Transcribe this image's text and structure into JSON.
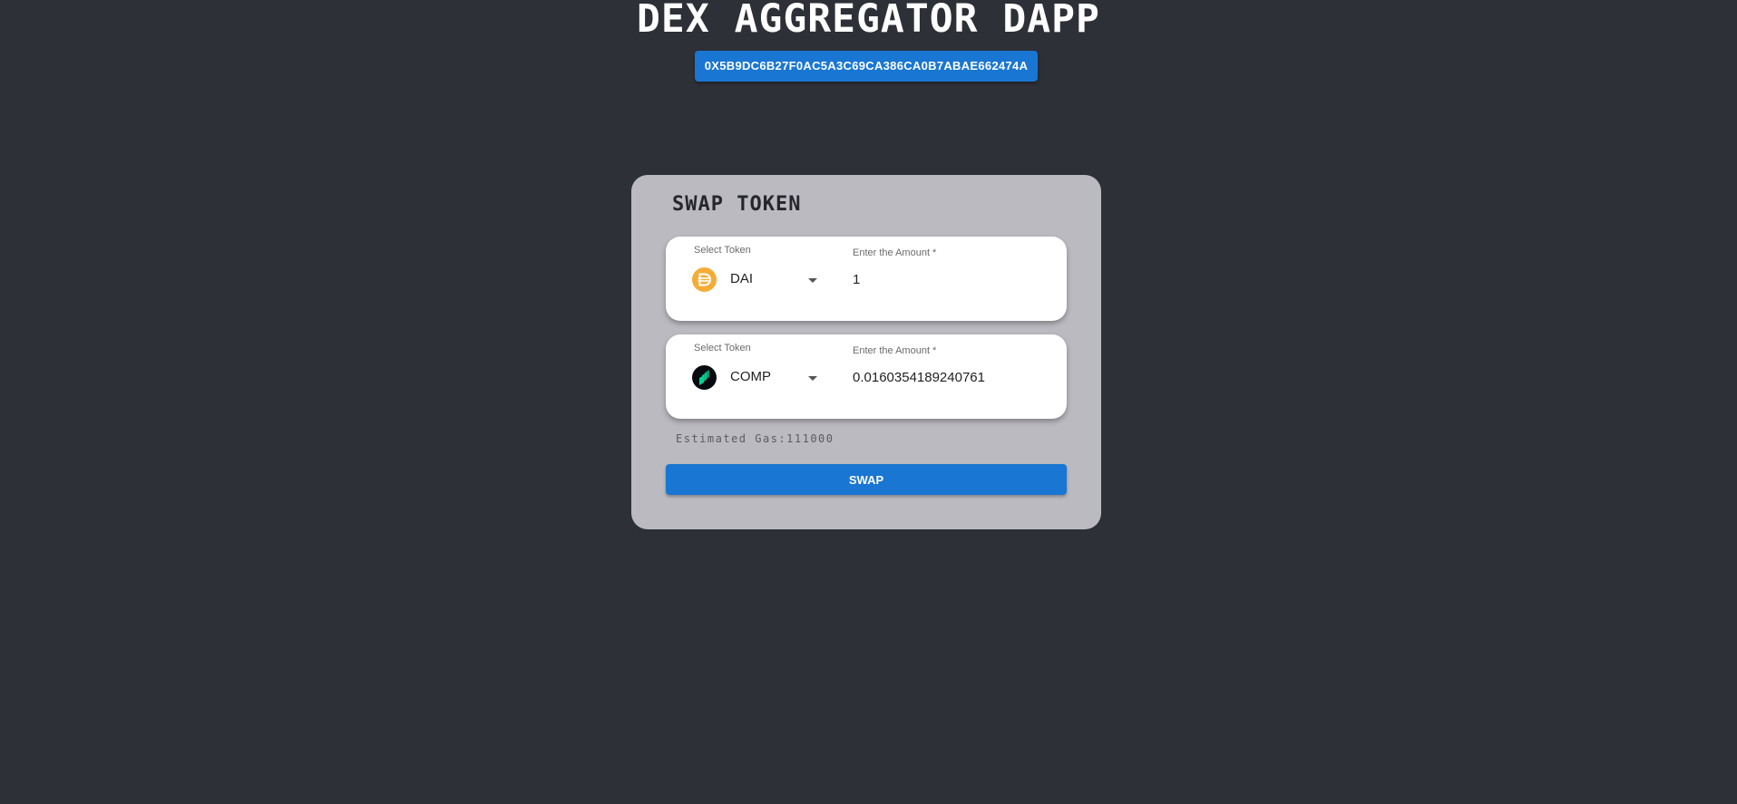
{
  "header": {
    "title": "DEX AGGREGATOR DAPP",
    "wallet_address": "0X5B9DC6B27F0AC5A3C69CA386CA0B7ABAE662474A"
  },
  "swap": {
    "title": "SWAP TOKEN",
    "from": {
      "select_label": "Select Token",
      "token": "DAI",
      "token_icon": "dai-icon",
      "amount_label": "Enter the Amount *",
      "amount": "1"
    },
    "to": {
      "select_label": "Select Token",
      "token": "COMP",
      "token_icon": "comp-icon",
      "amount_label": "Enter the Amount *",
      "amount": "0.0160354189240761"
    },
    "estimated_gas": "Estimated Gas:111000",
    "swap_button_label": "SWAP"
  },
  "colors": {
    "background": "#2e3037",
    "card": "#bbbac0",
    "accent": "#1976d2",
    "dai": "#f5ac37",
    "comp": "#00d395"
  }
}
